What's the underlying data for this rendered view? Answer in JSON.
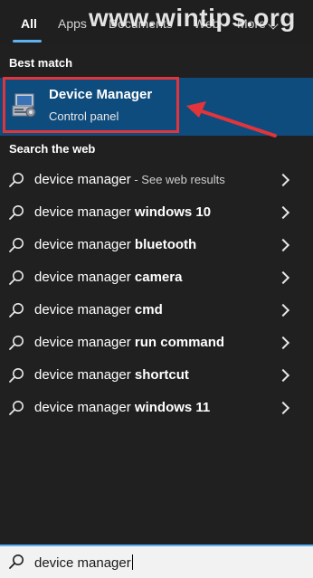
{
  "tabs": [
    {
      "label": "All",
      "active": true
    },
    {
      "label": "Apps"
    },
    {
      "label": "Documents"
    },
    {
      "label": "Web"
    },
    {
      "label": "More"
    }
  ],
  "watermark": "www.wintips.org",
  "best_match": {
    "section_label": "Best match",
    "title": "Device Manager",
    "subtitle": "Control panel",
    "icon": "device-manager-icon"
  },
  "web": {
    "section_label": "Search the web",
    "results": [
      {
        "query": "device manager",
        "suffix": "",
        "hint": " - See web results"
      },
      {
        "query": "device manager ",
        "suffix": "windows 10",
        "hint": ""
      },
      {
        "query": "device manager ",
        "suffix": "bluetooth",
        "hint": ""
      },
      {
        "query": "device manager ",
        "suffix": "camera",
        "hint": ""
      },
      {
        "query": "device manager ",
        "suffix": "cmd",
        "hint": ""
      },
      {
        "query": "device manager ",
        "suffix": "run command",
        "hint": ""
      },
      {
        "query": "device manager ",
        "suffix": "shortcut",
        "hint": ""
      },
      {
        "query": "device manager ",
        "suffix": "windows 11",
        "hint": ""
      }
    ]
  },
  "search": {
    "value": "device manager",
    "icon": "search-icon"
  },
  "colors": {
    "accent": "#5fb2f2",
    "selected_bg": "#0f4c7e",
    "highlight_border": "#e2343b",
    "background": "#202020"
  }
}
